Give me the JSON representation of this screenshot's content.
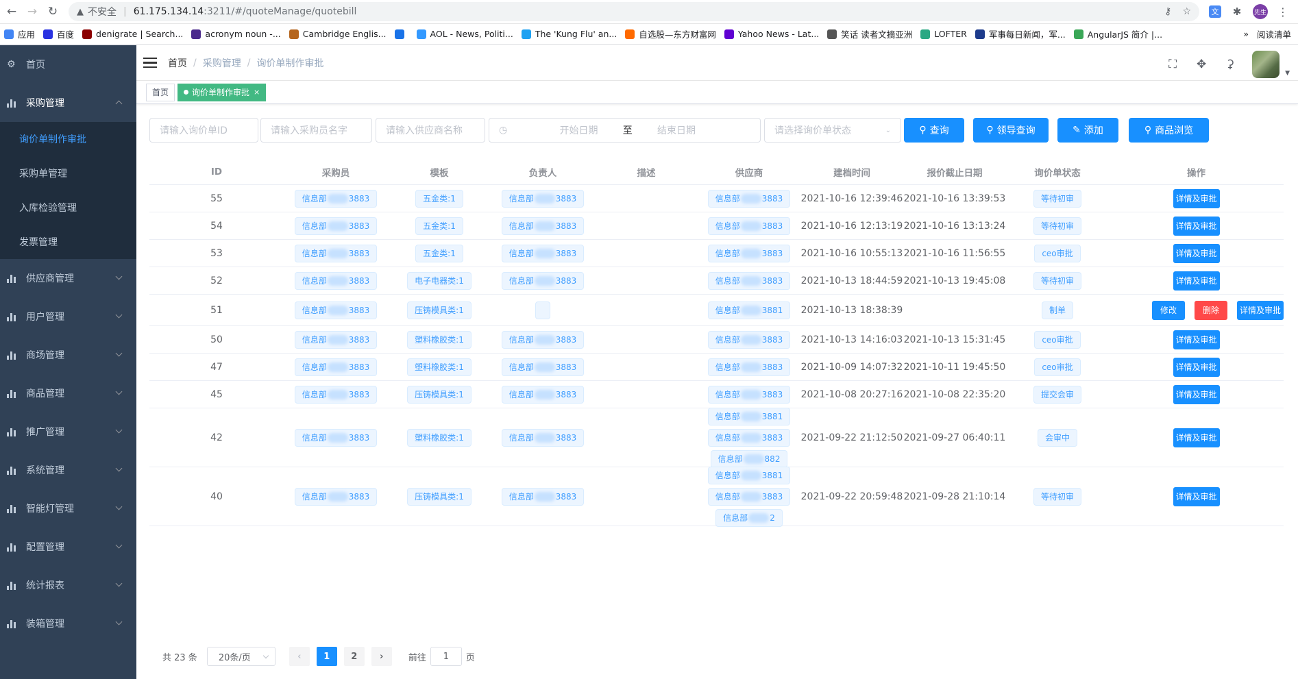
{
  "browser": {
    "insecure_label": "不安全",
    "url_host": "61.175.134.14",
    "url_path": ":3211/#/quoteManage/quotebill",
    "profile_label": "先生",
    "bookmarks": [
      {
        "label": "应用",
        "color": "#4285f4"
      },
      {
        "label": "百度",
        "color": "#2932e1"
      },
      {
        "label": "denigrate | Search...",
        "color": "#8b0000"
      },
      {
        "label": "acronym noun -...",
        "color": "#4b2a8c"
      },
      {
        "label": "Cambridge Englis...",
        "color": "#b5651d"
      },
      {
        "label": "",
        "color": "#1a73e8"
      },
      {
        "label": "AOL - News, Politi...",
        "color": "#3399ff"
      },
      {
        "label": "The 'Kung Flu' an...",
        "color": "#1ea1f2"
      },
      {
        "label": "自选股—东方财富网",
        "color": "#ff6a00"
      },
      {
        "label": "Yahoo News - Lat...",
        "color": "#6001d2"
      },
      {
        "label": "笑话 读者文摘亚洲",
        "color": "#555555"
      },
      {
        "label": "LOFTER",
        "color": "#2aa883"
      },
      {
        "label": "军事每日新闻，军...",
        "color": "#1d3b8c"
      },
      {
        "label": "AngularJS 简介 |...",
        "color": "#3aa757"
      }
    ],
    "more_label": "»",
    "reading_list": "阅读清单"
  },
  "sidebar": {
    "home": "首页",
    "items": [
      {
        "label": "采购管理",
        "open": true
      },
      {
        "label": "供应商管理"
      },
      {
        "label": "用户管理"
      },
      {
        "label": "商场管理"
      },
      {
        "label": "商品管理"
      },
      {
        "label": "推广管理"
      },
      {
        "label": "系统管理"
      },
      {
        "label": "智能灯管理"
      },
      {
        "label": "配置管理"
      },
      {
        "label": "统计报表"
      },
      {
        "label": "装箱管理"
      }
    ],
    "sub_items": [
      {
        "label": "询价单制作审批",
        "active": true
      },
      {
        "label": "采购单管理"
      },
      {
        "label": "入库检验管理"
      },
      {
        "label": "发票管理"
      }
    ]
  },
  "navbar": {
    "crumbs": [
      "首页",
      "采购管理",
      "询价单制作审批"
    ]
  },
  "tags": {
    "home": "首页",
    "active": "询价单制作审批",
    "close": "×"
  },
  "filters": {
    "id_placeholder": "请输入询价单ID",
    "buyer_placeholder": "请输入采购员名字",
    "supplier_placeholder": "请输入供应商名称",
    "start_date": "开始日期",
    "to": "至",
    "end_date": "结束日期",
    "status_placeholder": "请选择询价单状态",
    "btn_query": "查询",
    "btn_leader_query": "领导查询",
    "btn_add": "添加",
    "btn_browse": "商品浏览"
  },
  "table": {
    "headers": [
      "ID",
      "采购员",
      "模板",
      "负责人",
      "描述",
      "供应商",
      "建档时间",
      "报价截止日期",
      "询价单状态",
      "操作"
    ],
    "rows": [
      {
        "id": "55",
        "buyer": "3883",
        "template": "五金类:1",
        "owner": "3883",
        "suppliers": [
          "3883"
        ],
        "created": "2021-10-16 12:39:46",
        "deadline": "2021-10-16 13:39:53",
        "status": "等待初审",
        "ops": [
          "详情及审批"
        ]
      },
      {
        "id": "54",
        "buyer": "3883",
        "template": "五金类:1",
        "owner": "3883",
        "suppliers": [
          "3883"
        ],
        "created": "2021-10-16 12:13:19",
        "deadline": "2021-10-16 13:13:24",
        "status": "等待初审",
        "ops": [
          "详情及审批"
        ]
      },
      {
        "id": "53",
        "buyer": "3883",
        "template": "五金类:1",
        "owner": "3883",
        "suppliers": [
          "3883"
        ],
        "created": "2021-10-16 10:55:13",
        "deadline": "2021-10-16 11:56:55",
        "status": "ceo审批",
        "ops": [
          "详情及审批"
        ]
      },
      {
        "id": "52",
        "buyer": "3883",
        "template": "电子电器类:1",
        "owner": "3883",
        "suppliers": [
          "3883"
        ],
        "created": "2021-10-13 18:44:59",
        "deadline": "2021-10-13 19:45:08",
        "status": "等待初审",
        "ops": [
          "详情及审批"
        ]
      },
      {
        "id": "51",
        "buyer": "3883",
        "template": "压铸模具类:1",
        "owner": "",
        "suppliers": [
          "3881"
        ],
        "created": "2021-10-13 18:38:39",
        "deadline": "",
        "status": "制单",
        "ops": [
          "修改",
          "删除",
          "详情及审批"
        ]
      },
      {
        "id": "50",
        "buyer": "3883",
        "template": "塑料橡胶类:1",
        "owner": "3883",
        "suppliers": [
          "3883"
        ],
        "created": "2021-10-13 14:16:03",
        "deadline": "2021-10-13 15:31:45",
        "status": "ceo审批",
        "ops": [
          "详情及审批"
        ]
      },
      {
        "id": "47",
        "buyer": "3883",
        "template": "塑料橡胶类:1",
        "owner": "3883",
        "suppliers": [
          "3883"
        ],
        "created": "2021-10-09 14:07:32",
        "deadline": "2021-10-11 19:45:50",
        "status": "ceo审批",
        "ops": [
          "详情及审批"
        ]
      },
      {
        "id": "45",
        "buyer": "3883",
        "template": "压铸模具类:1",
        "owner": "3883",
        "suppliers": [
          "3883"
        ],
        "created": "2021-10-08 20:27:16",
        "deadline": "2021-10-08 22:35:20",
        "status": "提交会审",
        "ops": [
          "详情及审批"
        ]
      },
      {
        "id": "42",
        "buyer": "3883",
        "template": "塑料橡胶类:1",
        "owner": "3883",
        "suppliers": [
          "3881",
          "3883",
          "882"
        ],
        "created": "2021-09-22 21:12:50",
        "deadline": "2021-09-27 06:40:11",
        "status": "会审中",
        "ops": [
          "详情及审批"
        ]
      },
      {
        "id": "40",
        "buyer": "3883",
        "template": "压铸模具类:1",
        "owner": "3883",
        "suppliers": [
          "3881",
          "3883",
          "2"
        ],
        "created": "2021-09-22 20:59:48",
        "deadline": "2021-09-28 21:10:14",
        "status": "等待初审",
        "ops": [
          "详情及审批"
        ]
      }
    ],
    "name_prefix": "信息部"
  },
  "pager": {
    "total": "共 23 条",
    "page_size": "20条/页",
    "pages": [
      "1",
      "2"
    ],
    "goto": "前往",
    "goto_value": "1",
    "page_unit": "页"
  }
}
